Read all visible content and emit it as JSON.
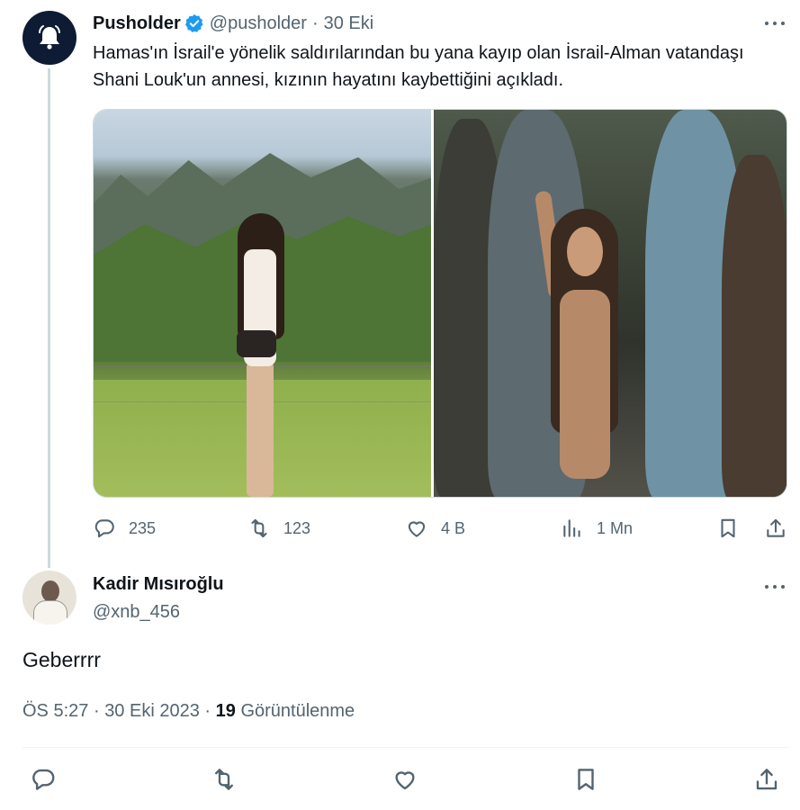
{
  "tweet": {
    "author_name": "Pusholder",
    "handle": "@pusholder",
    "separator": "·",
    "date": "30 Eki",
    "text": "Hamas'ın İsrail'e yönelik saldırılarından bu yana kayıp olan İsrail-Alman vatandaşı Shani Louk'un annesi, kızının hayatını kaybettiğini açıkladı.",
    "icons": {
      "avatar": "bell-icon",
      "verified": "verified-badge-icon",
      "more": "more-icon"
    },
    "stats": {
      "replies": "235",
      "retweets": "123",
      "likes": "4 B",
      "views": "1 Mn"
    }
  },
  "reply": {
    "author_name": "Kadir Mısıroğlu",
    "handle": "@xnb_456",
    "text": "Geberrrr",
    "time": "ÖS 5:27",
    "separator": "·",
    "date": "30 Eki 2023",
    "views_count": "19",
    "views_label": "Görüntülenme"
  },
  "colors": {
    "text": "#0f1419",
    "muted": "#536471",
    "verified": "#1d9bf0",
    "border": "#cfd9de",
    "avatar_bg": "#0d1b34"
  }
}
